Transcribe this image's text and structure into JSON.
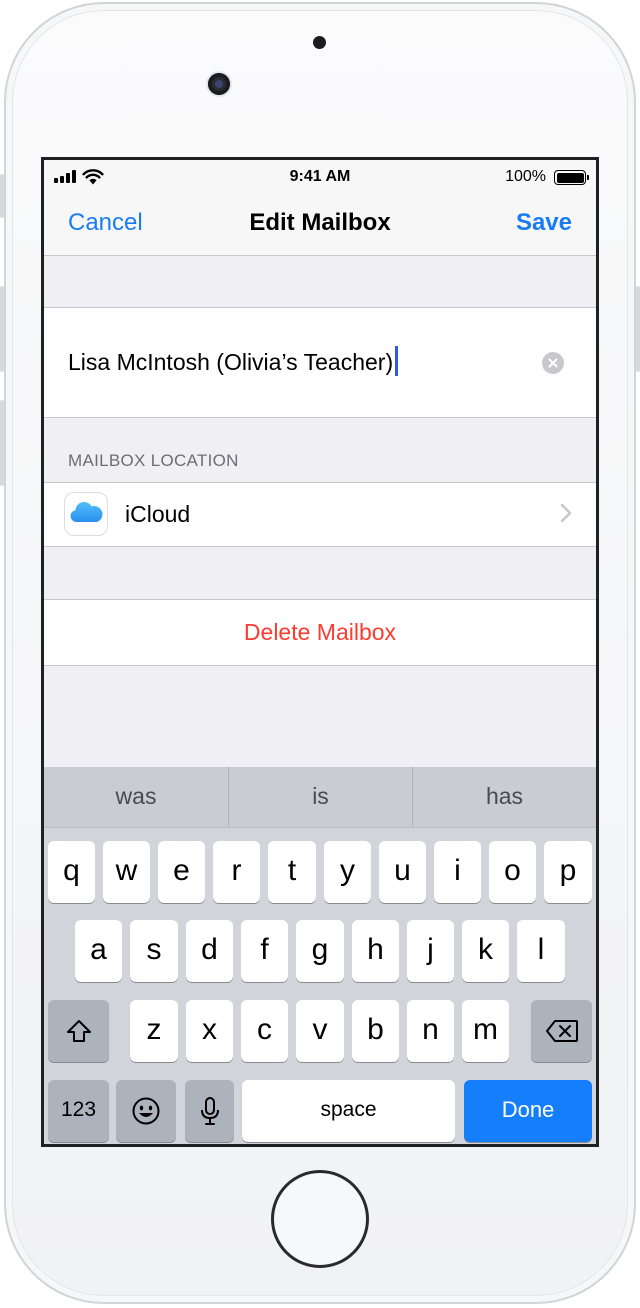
{
  "status_bar": {
    "time": "9:41 AM",
    "battery_percent": "100%",
    "battery_level": 1.0,
    "signal_icon": "cellular-signal-icon",
    "wifi_icon": "wifi-icon"
  },
  "nav": {
    "cancel_label": "Cancel",
    "title": "Edit Mailbox",
    "save_label": "Save"
  },
  "mailbox_name": {
    "value": "Lisa McIntosh (Olivia’s Teacher)",
    "clear_icon": "clear-icon"
  },
  "location": {
    "section_header": "MAILBOX LOCATION",
    "value": "iCloud",
    "icon": "icloud-icon",
    "chevron_icon": "chevron-right-icon"
  },
  "delete_label": "Delete Mailbox",
  "keyboard": {
    "predictions": [
      "was",
      "is",
      "has"
    ],
    "row1": [
      "q",
      "w",
      "e",
      "r",
      "t",
      "y",
      "u",
      "i",
      "o",
      "p"
    ],
    "row2": [
      "a",
      "s",
      "d",
      "f",
      "g",
      "h",
      "j",
      "k",
      "l"
    ],
    "row3": [
      "z",
      "x",
      "c",
      "v",
      "b",
      "n",
      "m"
    ],
    "numbers_label": "123",
    "space_label": "space",
    "done_label": "Done",
    "icons": {
      "shift": "shift-icon",
      "delete": "backspace-icon",
      "emoji": "emoji-icon",
      "mic": "microphone-icon"
    }
  },
  "colors": {
    "accent": "#1a7cf5",
    "destructive": "#ff3b30",
    "done_key": "#157efb",
    "caret": "#2d5be3"
  }
}
